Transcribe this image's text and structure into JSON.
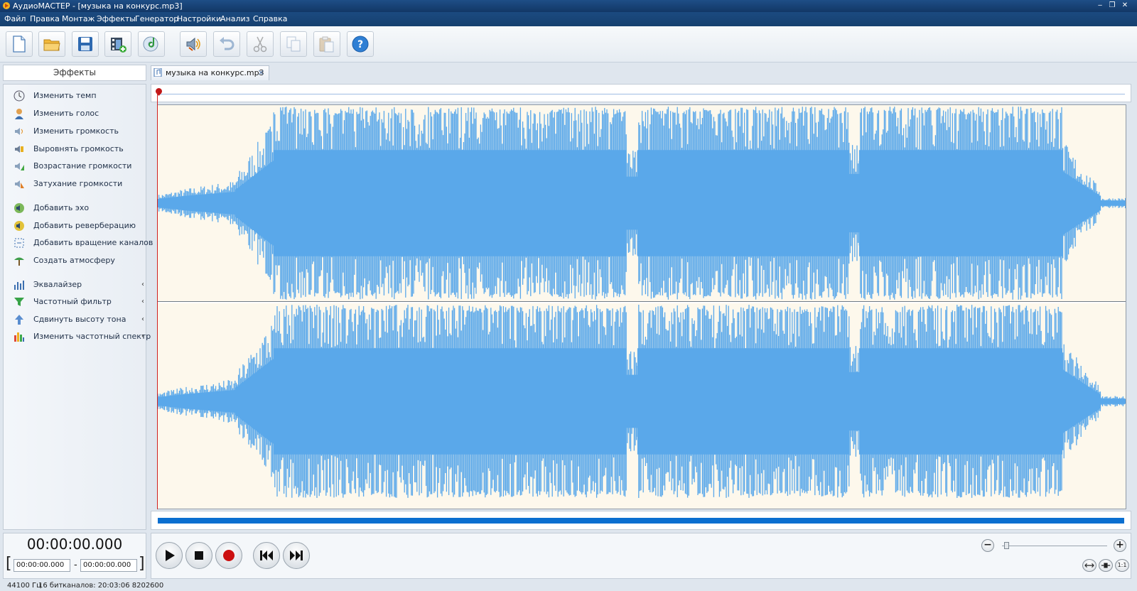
{
  "window": {
    "title": "АудиоМАСТЕР - [музыка на конкурс.mp3]",
    "controls": [
      "‒",
      "❐",
      "✕"
    ]
  },
  "menu": [
    "Файл",
    "Правка",
    "Монтаж",
    "Эффекты",
    "Генератор",
    "Настройки",
    "Анализ",
    "Справка"
  ],
  "toolbar": {
    "icons": [
      "new-file-icon",
      "open-folder-icon",
      "save-icon",
      "add-video-icon",
      "cd-rip-icon",
      "volume-effect-icon",
      "undo-icon",
      "cut-icon",
      "copy-icon",
      "paste-icon",
      "help-icon"
    ]
  },
  "effects": {
    "header": "Эффекты",
    "items": [
      {
        "label": "Изменить темп",
        "icon": "tempo-icon"
      },
      {
        "label": "Изменить голос",
        "icon": "voice-icon"
      },
      {
        "label": "Изменить громкость",
        "icon": "volume-icon"
      },
      {
        "label": "Выровнять громкость",
        "icon": "normalize-icon"
      },
      {
        "label": "Возрастание громкости",
        "icon": "fade-in-icon"
      },
      {
        "label": "Затухание громкости",
        "icon": "fade-out-icon"
      },
      {
        "label": "Добавить эхо",
        "icon": "echo-icon"
      },
      {
        "label": "Добавить реверберацию",
        "icon": "reverb-icon"
      },
      {
        "label": "Добавить вращение каналов",
        "icon": "rotate-channels-icon"
      },
      {
        "label": "Создать атмосферу",
        "icon": "atmosphere-icon"
      },
      {
        "label": "Эквалайзер",
        "icon": "equalizer-icon",
        "arrow": "‹"
      },
      {
        "label": "Частотный фильтр",
        "icon": "filter-icon",
        "arrow": "‹"
      },
      {
        "label": "Сдвинуть высоту тона",
        "icon": "pitch-icon",
        "arrow": "‹"
      },
      {
        "label": "Изменить частотный спектр",
        "icon": "spectrum-icon",
        "arrow": "‹"
      }
    ]
  },
  "document_tab": {
    "label": "музыка на конкурс.mp3",
    "close": "✕"
  },
  "playback": {
    "current_time": "00:00:00.000",
    "range_start": "00:00:00.000",
    "range_end": "00:00:00.000",
    "range_separator": "-",
    "bracket_open": "[",
    "bracket_close": "]"
  },
  "transport": {
    "buttons": [
      "play-icon",
      "stop-icon",
      "record-icon",
      "skip-back-icon",
      "skip-forward-icon"
    ]
  },
  "zoom": {
    "minus": "−",
    "plus": "+",
    "level": 0.02,
    "fit_buttons": [
      "fit-width-icon",
      "fit-selection-icon",
      "zoom-1-1-icon"
    ],
    "one_to_one": "1:1"
  },
  "status": {
    "sample_rate": "44100 Гц",
    "bit_depth": "16 бит",
    "channels": "каналов: 2",
    "duration": "0:03:06 8202600"
  },
  "colors": {
    "waveform": "#5aa8ea",
    "wave_background": "#fdf8ec",
    "playhead": "#d02020",
    "progress": "#0a6fd0",
    "titlebar": "#16406f"
  }
}
